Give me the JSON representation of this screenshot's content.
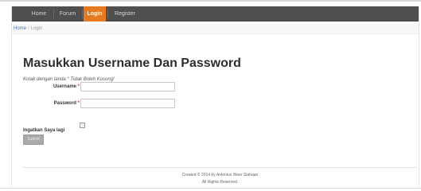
{
  "nav": {
    "items": [
      {
        "label": "Home"
      },
      {
        "label": "Forum"
      },
      {
        "label": "Login"
      },
      {
        "label": "Register"
      }
    ],
    "active_color": "#e8791f"
  },
  "breadcrumb": {
    "home": "Home",
    "separator": "/",
    "current": "Login"
  },
  "heading": "Masukkan Username Dan Password",
  "note": {
    "prefix": "Kotak dengan tanda",
    "star": "*",
    "suffix": "Tidak Boleh Kosong!"
  },
  "form": {
    "username_label": "Username",
    "password_label": "Password",
    "required_mark": "*",
    "username_value": "",
    "password_value": "",
    "remember_label": "Ingatkan Saya lagi",
    "remember_checked": false,
    "submit_label": "Submit"
  },
  "footer": {
    "line1": "Created © 2014 by Antonius Weer Siahaan",
    "line2": "All Rights Reserved."
  }
}
